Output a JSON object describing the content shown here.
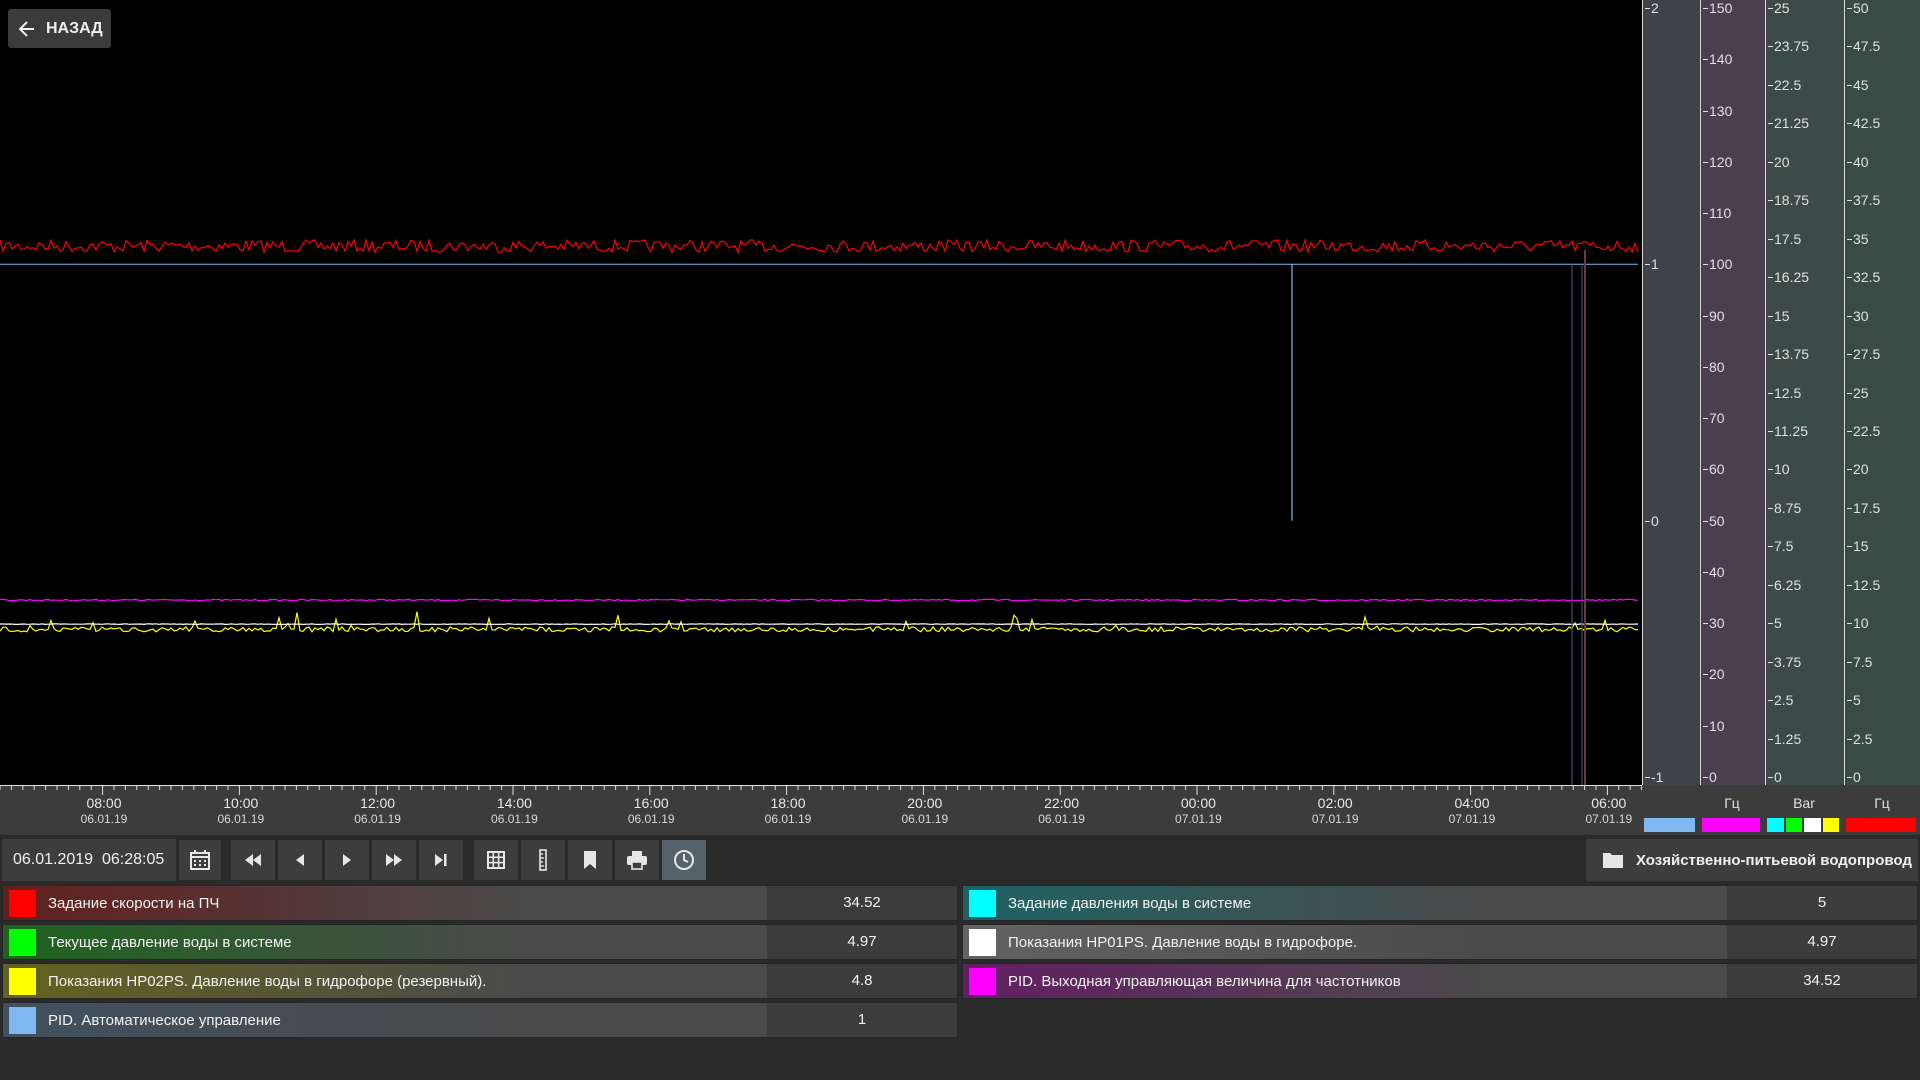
{
  "navigation": {
    "back_label": "НАЗАД"
  },
  "axes": [
    {
      "name": "pid-auto",
      "ticks": [
        "2",
        "1",
        "0",
        "-1"
      ],
      "unit": "",
      "bg": "#3f4247",
      "colors": [
        "#7fb8f0"
      ]
    },
    {
      "name": "hz-1",
      "ticks": [
        "150",
        "140",
        "130",
        "120",
        "110",
        "100",
        "90",
        "80",
        "70",
        "60",
        "50",
        "40",
        "30",
        "20",
        "10",
        "0"
      ],
      "unit": "Гц",
      "bg": "#4a3f4f",
      "colors": [
        "#ff00ff"
      ]
    },
    {
      "name": "bar",
      "ticks": [
        "25",
        "23.75",
        "22.5",
        "21.25",
        "20",
        "18.75",
        "17.5",
        "16.25",
        "15",
        "13.75",
        "12.5",
        "11.25",
        "10",
        "8.75",
        "7.5",
        "6.25",
        "5",
        "3.75",
        "2.5",
        "1.25",
        "0"
      ],
      "unit": "Bar",
      "bg": "#3c4a48",
      "colors": [
        "#00ffff",
        "#00ff00",
        "#ffffff",
        "#ffff00"
      ]
    },
    {
      "name": "hz-2",
      "ticks": [
        "50",
        "47.5",
        "45",
        "42.5",
        "40",
        "37.5",
        "35",
        "32.5",
        "30",
        "27.5",
        "25",
        "22.5",
        "20",
        "17.5",
        "15",
        "12.5",
        "10",
        "7.5",
        "5",
        "2.5",
        "0"
      ],
      "unit": "Гц",
      "bg": "#3a4a45",
      "colors": [
        "#ff0000"
      ]
    }
  ],
  "time_axis": [
    {
      "time": "08:00",
      "date": "06.01.19"
    },
    {
      "time": "10:00",
      "date": "06.01.19"
    },
    {
      "time": "12:00",
      "date": "06.01.19"
    },
    {
      "time": "14:00",
      "date": "06.01.19"
    },
    {
      "time": "16:00",
      "date": "06.01.19"
    },
    {
      "time": "18:00",
      "date": "06.01.19"
    },
    {
      "time": "20:00",
      "date": "06.01.19"
    },
    {
      "time": "22:00",
      "date": "06.01.19"
    },
    {
      "time": "00:00",
      "date": "07.01.19"
    },
    {
      "time": "02:00",
      "date": "07.01.19"
    },
    {
      "time": "04:00",
      "date": "07.01.19"
    },
    {
      "time": "06:00",
      "date": "07.01.19"
    }
  ],
  "toolbar": {
    "date": "06.01.2019",
    "time": "06:28:05",
    "buttons": [
      "calendar-icon",
      "rewind-icon",
      "step-back-icon",
      "play-icon",
      "fast-forward-icon",
      "skip-end-icon",
      "grid-icon",
      "ruler-icon",
      "bookmark-icon",
      "print-icon",
      "clock-icon"
    ],
    "folder_label": "Хозяйственно-питьевой водопровод"
  },
  "legend": {
    "left": [
      {
        "label": "Задание скорости на ПЧ",
        "value": "34.52",
        "color": "#ff0000"
      },
      {
        "label": "Текущее давление воды в системе",
        "value": "4.97",
        "color": "#00ff00"
      },
      {
        "label": "Показания HP02PS. Давление воды в гидрофоре (резервный).",
        "value": "4.8",
        "color": "#ffff00"
      },
      {
        "label": "PID. Автоматическое управление",
        "value": "1",
        "color": "#7fb8f0"
      }
    ],
    "right": [
      {
        "label": "Задание давления воды в системе",
        "value": "5",
        "color": "#00ffff"
      },
      {
        "label": "Показания HP01PS. Давление воды в гидрофоре.",
        "value": "4.97",
        "color": "#ffffff"
      },
      {
        "label": "PID. Выходная управляющая величина для частотников",
        "value": "34.52",
        "color": "#ff00ff"
      }
    ]
  },
  "chart_data": {
    "type": "line",
    "x_range": [
      "06.01.19 07:00",
      "07.01.19 07:00"
    ],
    "series": [
      {
        "name": "Задание скорости на ПЧ",
        "color": "#ff0000",
        "axis": "hz-2",
        "level": 34.52,
        "noise": 0.4
      },
      {
        "name": "PID. Выходная управляющая величина для частотников",
        "color": "#ff00ff",
        "axis": "hz-1",
        "level": 34.52,
        "noise": 0.15
      },
      {
        "name": "Показания HP02PS. Давление воды в гидрофоре (резервный).",
        "color": "#ffff00",
        "axis": "bar",
        "level": 4.8,
        "noise": 0.08
      },
      {
        "name": "Показания HP01PS. Давление воды в гидрофоре.",
        "color": "#ffffff",
        "axis": "bar",
        "level": 4.97,
        "noise": 0.01
      },
      {
        "name": "PID. Автоматическое управление",
        "color": "#7fb8f0",
        "axis": "pid-auto",
        "level": 1,
        "noise": 0
      }
    ]
  }
}
